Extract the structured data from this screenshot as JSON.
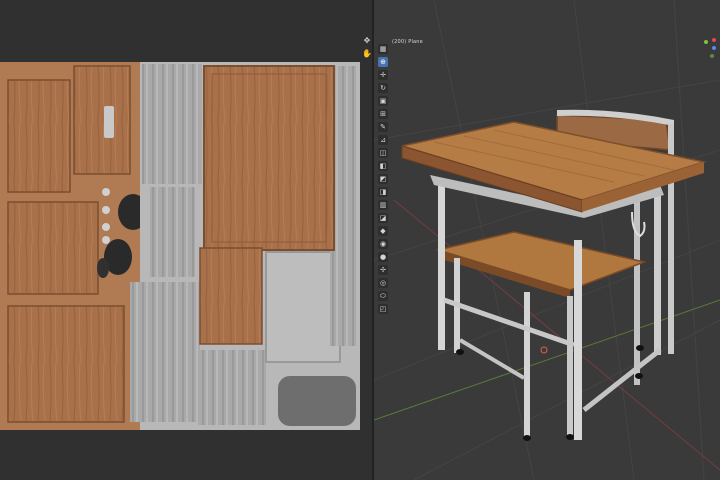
{
  "viewport": {
    "object_label": "(200) Plane",
    "tool_icons": [
      "select-box-icon",
      "cursor-icon",
      "move-icon",
      "rotate-icon",
      "scale-icon",
      "transform-icon",
      "annotate-icon",
      "measure-icon",
      "add-cube-icon",
      "extrude-icon",
      "inset-icon",
      "bevel-icon",
      "loop-cut-icon",
      "knife-icon",
      "poly-build-icon",
      "spin-icon",
      "smooth-icon",
      "edge-slide-icon",
      "shrink-fatten-icon",
      "shear-icon",
      "rip-icon"
    ]
  },
  "uv_editor": {
    "side_icons": [
      "pin-icon",
      "hand-icon"
    ]
  },
  "colors": {
    "wood": "#b07a52",
    "metal": "#c8c8c8",
    "active_tool": "#4772b3",
    "gizmo_x": "#e04b4b",
    "gizmo_y": "#7fc043",
    "gizmo_z": "#4c8df6"
  }
}
